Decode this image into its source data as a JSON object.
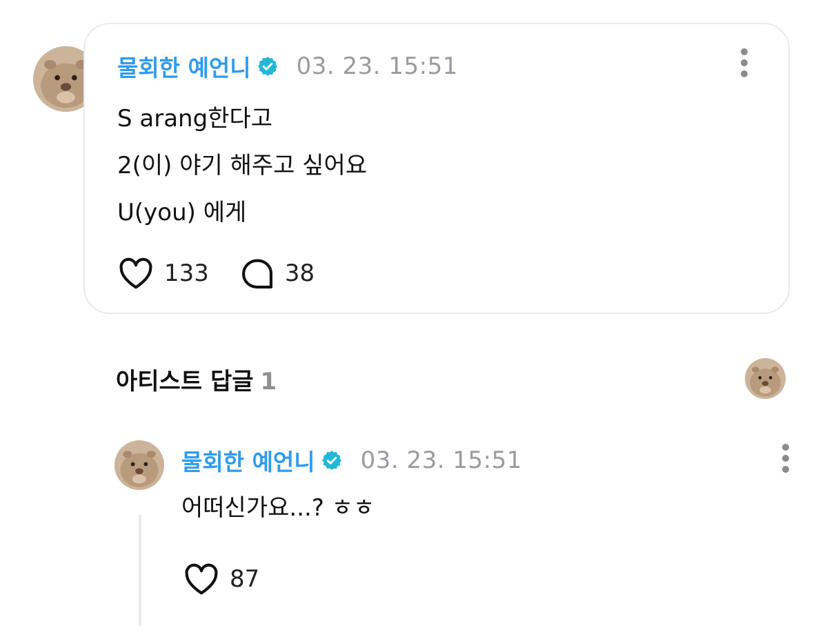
{
  "post": {
    "author": "물회한 예언니",
    "verified": true,
    "timestamp": "03. 23. 15:51",
    "lines": [
      "S arang한다고",
      "2(이) 야기 해주고 싶어요",
      "U(you) 에게"
    ],
    "likes": "133",
    "comments": "38",
    "icons": {
      "like": "heart-icon",
      "comment": "comment-bubble-icon",
      "more": "more-vertical-icon",
      "verified": "verified-badge-icon"
    }
  },
  "replies_section": {
    "title": "아티스트 답글",
    "count": "1"
  },
  "reply": {
    "author": "물회한 예언니",
    "verified": true,
    "timestamp": "03. 23. 15:51",
    "text": "어떠신가요...? ㅎㅎ",
    "likes": "87"
  },
  "colors": {
    "author": "#2f9bf0",
    "verified_badge": "#22b8d6",
    "timestamp": "#9a9aa0",
    "card_border": "#e9e9ee"
  }
}
